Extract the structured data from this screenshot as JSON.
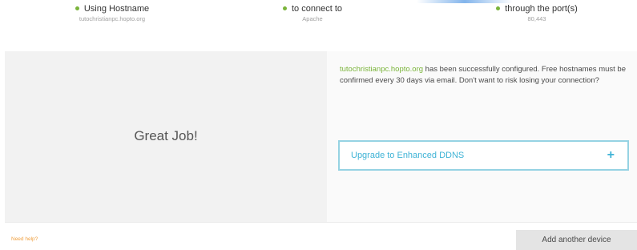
{
  "summary": {
    "items": [
      {
        "label": "Using Hostname",
        "value": "tutochristianpc.hopto.org"
      },
      {
        "label": "to connect to",
        "value": "Apache"
      },
      {
        "label": "through the port(s)",
        "value": "80,443"
      }
    ]
  },
  "result": {
    "heading": "Great Job!",
    "hostname": "tutochristianpc.hopto.org",
    "message": " has been successfully configured. Free hostnames must be confirmed every 30 days via email. Don't want to risk losing your connection?",
    "upgrade_label": "Upgrade to Enhanced DDNS",
    "upgrade_icon": "plus-icon"
  },
  "footer": {
    "help_link": "Need help?",
    "add_device_label": "Add another device"
  },
  "colors": {
    "accent_green": "#7ab43a",
    "accent_blue": "#3fb3d6",
    "link_orange": "#f0a040"
  }
}
